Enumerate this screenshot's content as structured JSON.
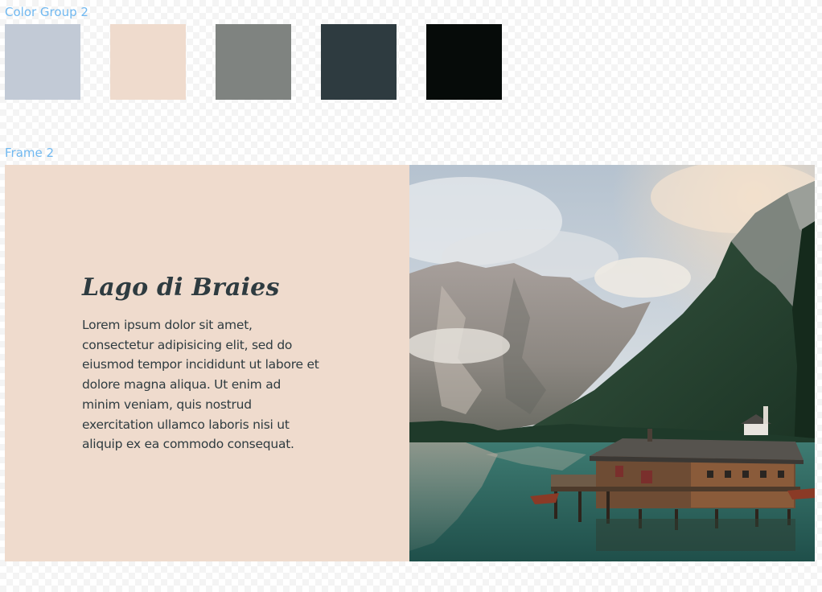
{
  "color_group": {
    "label": "Color Group 2",
    "swatches": [
      {
        "name": "light-blue-gray",
        "color": "#c2cad6"
      },
      {
        "name": "pale-peach",
        "color": "#efdbcd"
      },
      {
        "name": "medium-gray",
        "color": "#7f8380"
      },
      {
        "name": "dark-slate",
        "color": "#2e3b40"
      },
      {
        "name": "near-black",
        "color": "#060b09"
      }
    ]
  },
  "frame": {
    "label": "Frame 2",
    "background": "#efdbcd",
    "title": "Lago di Braies",
    "title_color": "#2e3b40",
    "body": "Lorem ipsum dolor sit amet, consectetur adipisicing elit, sed do eiusmod tempor incididunt ut labore et dolore magna aliqua. Ut enim ad minim veniam, quis nostrud exercitation ullamco laboris nisi ut aliquip ex ea commodo consequat.",
    "body_color": "#2e3b40",
    "photo_subject": "mountain-lake-with-boathouse"
  },
  "colors": {
    "layer_label": "#70b8f0"
  }
}
